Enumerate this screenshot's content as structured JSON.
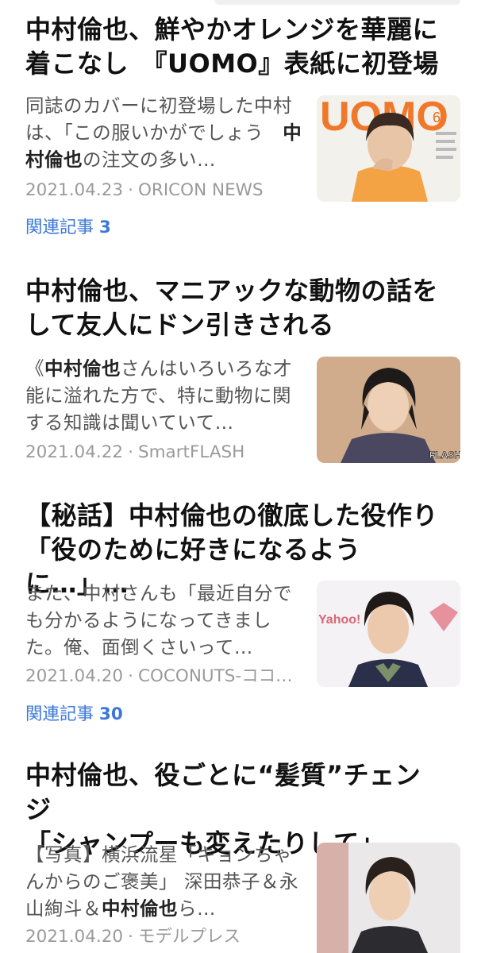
{
  "articles": [
    {
      "title_line1": "中村倫也、鮮やかオレンジを華麗に",
      "title_line2": "着こなし　『UOMO』表紙に初登場",
      "snippet_pre": "同誌のカバーに初登場した中村は、「この服いかがでしょう　",
      "snippet_bold": "中村倫也",
      "snippet_post": "の注文の多い…",
      "date": "2021.04.23",
      "source": "ORICON NEWS",
      "thumb_text": "UOMO",
      "thumb_sub": "6",
      "related_label": "関連記事",
      "related_count": "3"
    },
    {
      "title_line1": "中村倫也、マニアックな動物の話を",
      "title_line2": "して友人にドン引きされる",
      "snippet_pre": "《",
      "snippet_bold": "中村倫也",
      "snippet_post": "さんはいろいろな才能に溢れた方で、特に動物に関する知識は聞いていて…",
      "date": "2021.04.22",
      "source": "SmartFLASH",
      "thumb_text": "FLASH"
    },
    {
      "title_line1": "【秘話】中村倫也の徹底した役作り",
      "title_line2": "「役のために好きになるように…」…",
      "snippet_pre": "また、中村さんも「最近自分でも分かるようになってきました。俺、面倒くさいって…",
      "snippet_bold": "",
      "snippet_post": "",
      "date": "2021.04.20",
      "source": "COCONUTS-ココ…",
      "thumb_text": "Yahoo!",
      "related_label": "関連記事",
      "related_count": "30"
    },
    {
      "title_line1": "中村倫也、役ごとに“髪質”チェンジ",
      "title_line2": "「シャンプーも変えたりして」",
      "snippet_pre": "【写真】横浜流星「キョンちゃんからのご褒美」 深田恭子＆永山絢斗＆",
      "snippet_bold": "中村倫也",
      "snippet_post": "ら…",
      "date": "2021.04.20",
      "source": "モデルプレス"
    }
  ],
  "meta_separator": "·",
  "colors": {
    "title": "#111111",
    "snippet": "#555555",
    "meta": "#9a9a9a",
    "related_link": "#3d78d8",
    "uomo_orange": "#f0782a"
  },
  "icons": [
    "photo-thumbnail"
  ]
}
